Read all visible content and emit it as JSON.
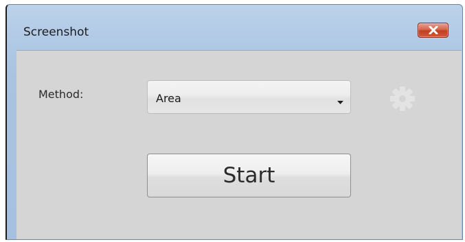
{
  "window": {
    "title": "Screenshot"
  },
  "icons": {
    "close": "close-icon",
    "dropdown": "chevron-down-icon",
    "settings": "gear-icon"
  },
  "form": {
    "method_label": "Method:",
    "method_value": "Area"
  },
  "actions": {
    "start_label": "Start"
  },
  "colors": {
    "title_bar": "#a9c3e1",
    "client_bg": "#d5d5d5",
    "close_button": "#c9492b"
  }
}
